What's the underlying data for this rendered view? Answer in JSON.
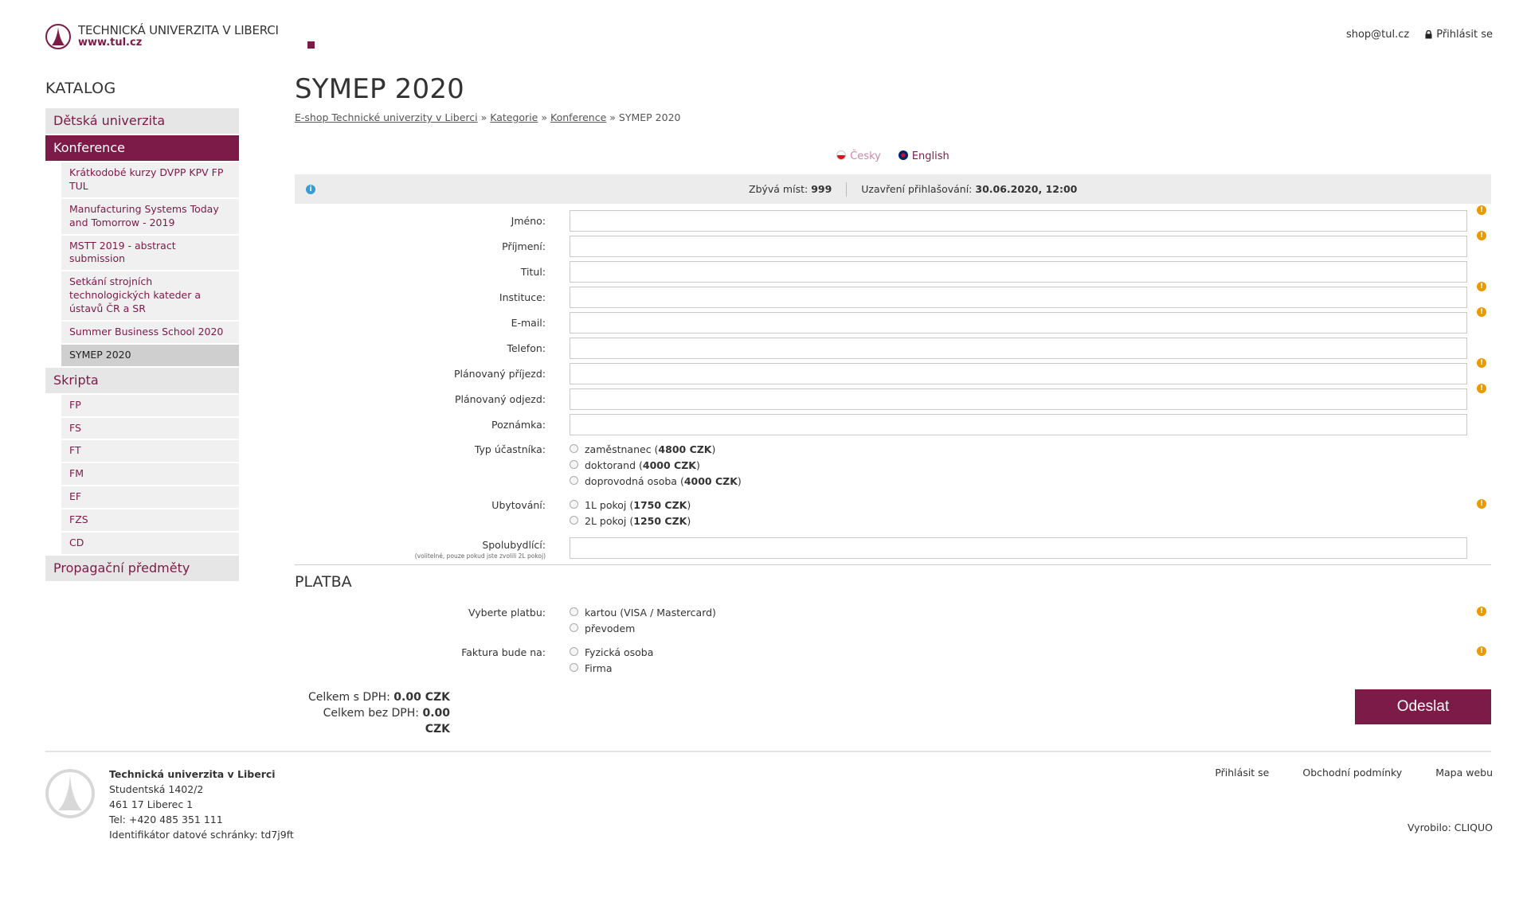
{
  "header": {
    "logo_name": "TECHNICKÁ UNIVERZITA V LIBERCI",
    "logo_url": "www.tul.cz",
    "email": "shop@tul.cz",
    "login": "Přihlásit se"
  },
  "sidebar": {
    "title": "KATALOG",
    "items": [
      {
        "label": "Dětská univerzita"
      },
      {
        "label": "Konference"
      },
      {
        "label": "Krátkodobé kurzy DVPP KPV FP TUL"
      },
      {
        "label": "Manufacturing Systems Today and Tomorrow - 2019"
      },
      {
        "label": "MSTT 2019 - abstract submission"
      },
      {
        "label": "Setkání strojních technologických kateder a ústavů ČR a SR"
      },
      {
        "label": "Summer Business School 2020"
      },
      {
        "label": "SYMEP 2020"
      },
      {
        "label": "Skripta"
      },
      {
        "label": "FP"
      },
      {
        "label": "FS"
      },
      {
        "label": "FT"
      },
      {
        "label": "FM"
      },
      {
        "label": "EF"
      },
      {
        "label": "FZS"
      },
      {
        "label": "CD"
      },
      {
        "label": "Propagační předměty"
      }
    ]
  },
  "main": {
    "title": "SYMEP 2020",
    "breadcrumb": [
      "E-shop Technické univerzity v Liberci",
      "Kategorie",
      "Konference",
      "SYMEP 2020"
    ],
    "breadcrumb_sep": "»",
    "languages": [
      "Česky",
      "English"
    ],
    "info": {
      "places_label": "Zbývá míst:",
      "places_value": "999",
      "closing_label": "Uzavření přihlašování:",
      "closing_value": "30.06.2020, 12:00"
    },
    "fields": [
      {
        "label": "Jméno:",
        "value": "",
        "required": true
      },
      {
        "label": "Příjmení:",
        "value": "",
        "required": true
      },
      {
        "label": "Titul:",
        "value": "",
        "required": false
      },
      {
        "label": "Instituce:",
        "value": "",
        "required": true
      },
      {
        "label": "E-mail:",
        "value": "",
        "required": true
      },
      {
        "label": "Telefon:",
        "value": "",
        "required": false
      },
      {
        "label": "Plánovaný příjezd:",
        "value": "",
        "required": true
      },
      {
        "label": "Plánovaný odjezd:",
        "value": "",
        "required": true
      },
      {
        "label": "Poznámka:",
        "value": "",
        "required": false
      }
    ],
    "participant_type": {
      "label": "Typ účastníka:",
      "options": [
        {
          "text": "zaměstnanec (",
          "price": "4800 CZK",
          "close": ")"
        },
        {
          "text": "doktorand (",
          "price": "4000 CZK",
          "close": ")"
        },
        {
          "text": "doprovodná osoba (",
          "price": "4000 CZK",
          "close": ")"
        }
      ]
    },
    "accommodation": {
      "label": "Ubytování:",
      "options": [
        {
          "text": "1L pokoj (",
          "price": "1750 CZK",
          "close": ")"
        },
        {
          "text": "2L pokoj (",
          "price": "1250 CZK",
          "close": ")"
        }
      ]
    },
    "roommate": {
      "label": "Spolubydlící:",
      "note": "(volitelné, pouze pokud jste zvolili 2L pokoj)",
      "value": ""
    },
    "payment_title": "PLATBA",
    "payment": {
      "label": "Vyberte platbu:",
      "options": [
        "kartou (VISA / Mastercard)",
        "převodem"
      ]
    },
    "invoice": {
      "label": "Faktura bude na:",
      "options": [
        "Fyzická osoba",
        "Firma"
      ]
    },
    "totals": {
      "with_vat_label": "Celkem s DPH:",
      "with_vat_value": "0.00 CZK",
      "without_vat_label": "Celkem bez DPH:",
      "without_vat_value": "0.00 CZK"
    },
    "submit": "Odeslat"
  },
  "footer": {
    "org": "Technická univerzita v Liberci",
    "street": "Studentská 1402/2",
    "city": "461 17 Liberec 1",
    "phone": "Tel: +420 485 351 111",
    "databox": "Identifikátor datové schránky: td7j9ft",
    "links": [
      "Přihlásit se",
      "Obchodní podmínky",
      "Mapa webu"
    ],
    "made_by": "Vyrobilo: CLIQUO"
  },
  "colors": {
    "brand": "#7c1a48",
    "warning": "#e89a00",
    "info": "#3a9bd5"
  }
}
